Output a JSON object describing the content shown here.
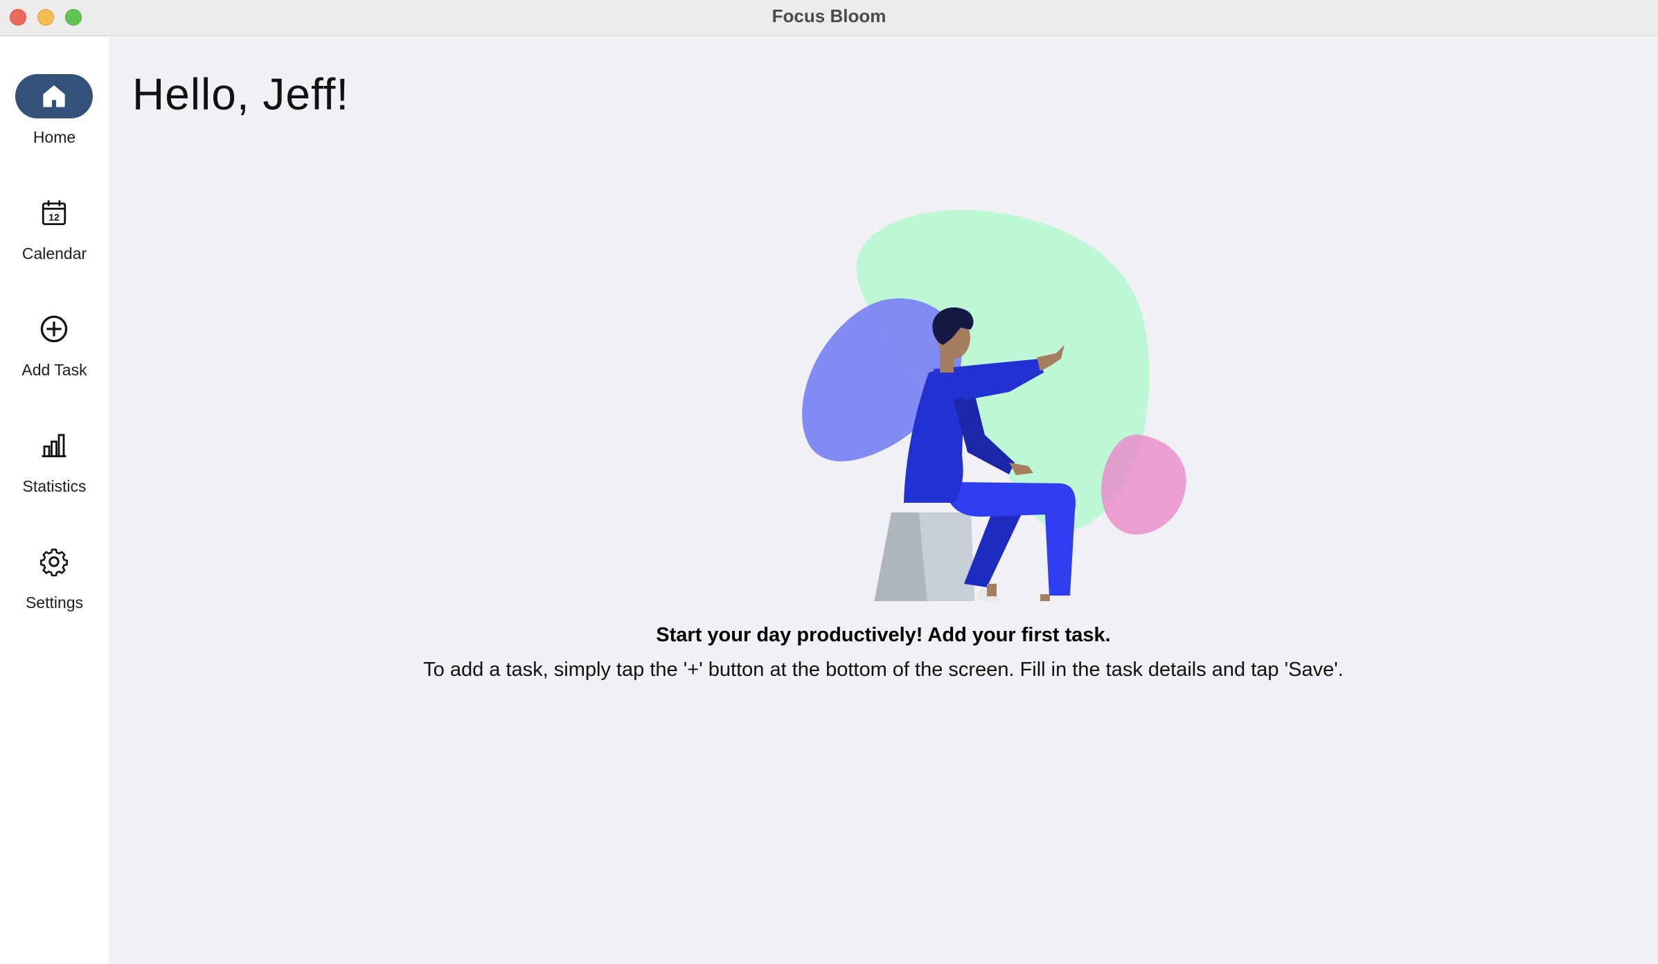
{
  "window": {
    "title": "Focus Bloom"
  },
  "sidebar": {
    "items": [
      {
        "label": "Home",
        "icon": "home-icon",
        "active": true
      },
      {
        "label": "Calendar",
        "icon": "calendar-icon",
        "active": false
      },
      {
        "label": "Add Task",
        "icon": "plus-circle-icon",
        "active": false
      },
      {
        "label": "Statistics",
        "icon": "bar-chart-icon",
        "active": false
      },
      {
        "label": "Settings",
        "icon": "gear-icon",
        "active": false
      }
    ],
    "calendar_day": "12"
  },
  "main": {
    "greeting": "Hello, Jeff!",
    "empty_state": {
      "title": "Start your day productively! Add your first task.",
      "description": "To add a task, simply tap the '+' button at the bottom of the screen. Fill in the task details and tap 'Save'."
    }
  },
  "colors": {
    "accent": "#34517a",
    "sidebar_bg": "#ffffff",
    "main_bg": "#f0f0f5",
    "blob_green": "#bdf8d6",
    "blob_purple": "#8088f5",
    "blob_pink": "#ee9fd3",
    "figure_blue": "#2433d0"
  }
}
